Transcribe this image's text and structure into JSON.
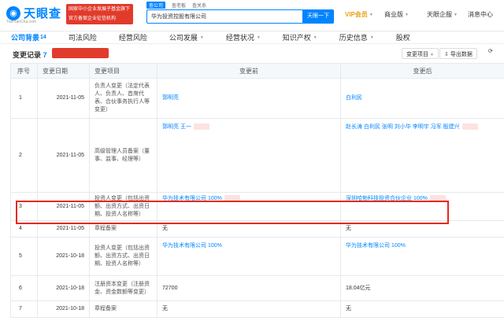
{
  "header": {
    "logo_text": "天眼查",
    "logo_sub": "TianYanCha.com",
    "banner_line1": "国家中小企业发展子基金旗下",
    "banner_line2": "官方备案企业征信机构",
    "search_tabs": [
      "查公司",
      "查老板",
      "查关系"
    ],
    "search_value": "华为投资控股有限公司",
    "search_button": "天眼一下",
    "nav_vip": "VIP会员",
    "nav_product": "商业版",
    "nav_enterprise": "天眼企服",
    "nav_messages": "消息中心"
  },
  "tabs": [
    {
      "label": "公司背景",
      "count": "14",
      "active": true
    },
    {
      "label": "司法风险",
      "count": "",
      "active": false
    },
    {
      "label": "经营风险",
      "count": "",
      "active": false
    },
    {
      "label": "公司发展",
      "count": "",
      "active": false
    },
    {
      "label": "经营状况",
      "count": "",
      "active": false
    },
    {
      "label": "知识产权",
      "count": "",
      "active": false
    },
    {
      "label": "历史信息",
      "count": "",
      "active": false
    },
    {
      "label": "股权",
      "count": "",
      "active": false
    }
  ],
  "section": {
    "title": "变更记录",
    "count": "7",
    "badge": "",
    "filter_label": "变更项目",
    "export_label": "导出数据"
  },
  "table": {
    "headers": [
      "序号",
      "变更日期",
      "变更项目",
      "变更前",
      "变更后"
    ],
    "rows": [
      {
        "seq": "1",
        "date": "2021-11-05",
        "item": "负责人变更（法定代表人、负责人、首席代表、合伙事务执行人等变更）",
        "before": "郭明亮",
        "after": "白利民"
      },
      {
        "seq": "2",
        "date": "2021-11-05",
        "item": "高级管理人员备案（董事、监事、经理等）",
        "before": "郭明亮 王一",
        "after": "赵长涛 白利民 张明 刘小华 李明宇 冯军 殷建兴"
      },
      {
        "seq": "3",
        "date": "2021-11-05",
        "item": "投资人变更（包括出资额、出资方式、出资日期、投资人名称等）",
        "before": "华为技术有限公司 100%",
        "after": "深圳哈勃科技投资合伙企业 100%"
      },
      {
        "seq": "4",
        "date": "2021-11-05",
        "item": "章程备案",
        "before": "无",
        "after": "无"
      },
      {
        "seq": "5",
        "date": "2021-10-18",
        "item": "投资人变更（包括出资额、出资方式、出资日期、投资人名称等）",
        "before": "华为技术有限公司 100%",
        "after": "华为技术有限公司 100%"
      },
      {
        "seq": "6",
        "date": "2021-10-18",
        "item": "注册资本变更（注册资金、资金数额等变更）",
        "before": "72700",
        "after": "18.04亿元"
      },
      {
        "seq": "7",
        "date": "2021-10-18",
        "item": "章程备案",
        "before": "无",
        "after": "无"
      }
    ]
  }
}
